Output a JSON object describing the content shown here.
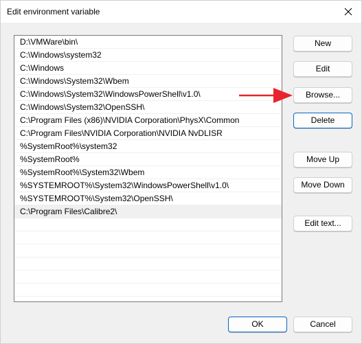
{
  "window": {
    "title": "Edit environment variable"
  },
  "list": {
    "items": [
      "D:\\VMWare\\bin\\",
      "C:\\Windows\\system32",
      "C:\\Windows",
      "C:\\Windows\\System32\\Wbem",
      "C:\\Windows\\System32\\WindowsPowerShell\\v1.0\\",
      "C:\\Windows\\System32\\OpenSSH\\",
      "C:\\Program Files (x86)\\NVIDIA Corporation\\PhysX\\Common",
      "C:\\Program Files\\NVIDIA Corporation\\NVIDIA NvDLISR",
      "%SystemRoot%\\system32",
      "%SystemRoot%",
      "%SystemRoot%\\System32\\Wbem",
      "%SYSTEMROOT%\\System32\\WindowsPowerShell\\v1.0\\",
      "%SYSTEMROOT%\\System32\\OpenSSH\\",
      "C:\\Program Files\\Calibre2\\"
    ],
    "selected_index": 13
  },
  "buttons": {
    "new": "New",
    "edit": "Edit",
    "browse": "Browse...",
    "delete": "Delete",
    "move_up": "Move Up",
    "move_down": "Move Down",
    "edit_text": "Edit text...",
    "ok": "OK",
    "cancel": "Cancel"
  },
  "icons": {
    "close": "close-icon",
    "annotation": "red-arrow-icon"
  },
  "colors": {
    "accent": "#0a64c4",
    "annotation_arrow": "#e8232d"
  }
}
